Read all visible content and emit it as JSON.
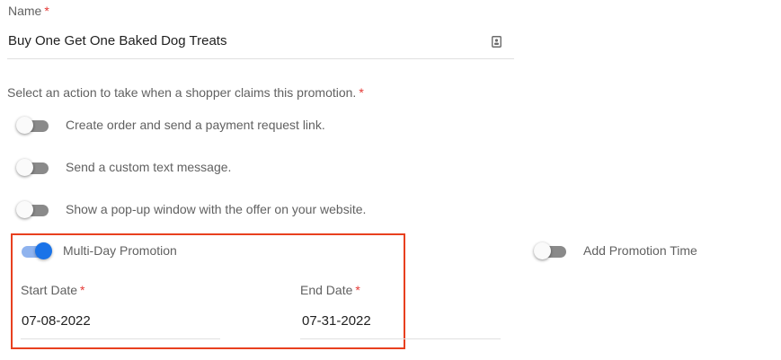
{
  "name_field": {
    "label": "Name",
    "required_mark": "*",
    "value": "Buy One Get One Baked Dog Treats",
    "icon": "contact-card-icon"
  },
  "actions": {
    "prompt": "Select an action to take when a shopper claims this promotion.",
    "required_mark": "*",
    "options": [
      {
        "label": "Create order and send a payment request link.",
        "enabled": false
      },
      {
        "label": "Send a custom text message.",
        "enabled": false
      },
      {
        "label": "Show a pop-up window with the offer on your website.",
        "enabled": false
      }
    ]
  },
  "multi_day": {
    "label": "Multi-Day Promotion",
    "enabled": true
  },
  "promotion_time": {
    "label": "Add Promotion Time",
    "enabled": false
  },
  "start_date": {
    "label": "Start Date",
    "required_mark": "*",
    "value": "07-08-2022"
  },
  "end_date": {
    "label": "End Date",
    "required_mark": "*",
    "value": "07-31-2022"
  },
  "colors": {
    "accent": "#1a73e8",
    "required": "#e53935",
    "highlight_border": "#e8401f"
  }
}
